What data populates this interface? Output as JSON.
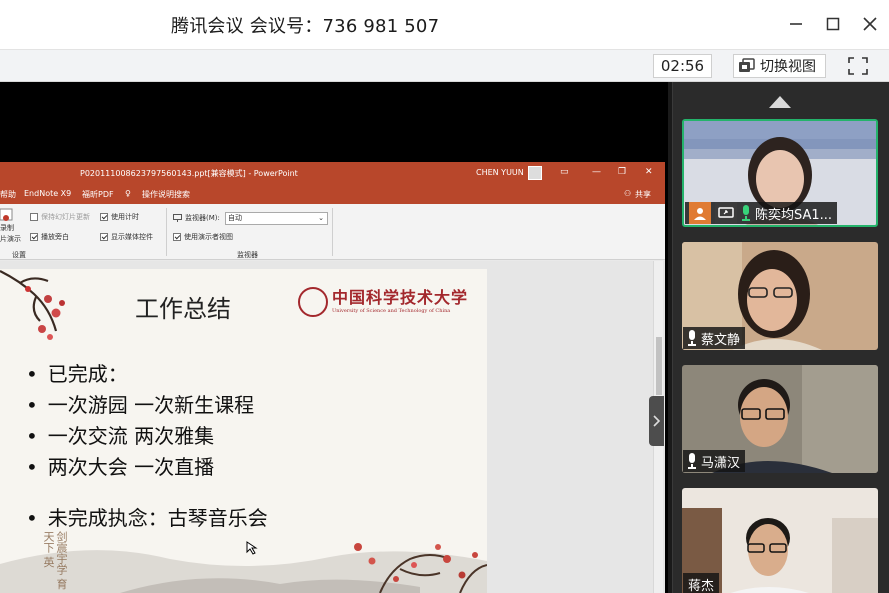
{
  "window": {
    "title": "腾讯会议 会议号：736 981 507"
  },
  "toolbar": {
    "timer": "02:56",
    "switch_view_label": "切换视图"
  },
  "ppt": {
    "file_title": "P020111008623797560143.ppt[兼容模式] - PowerPoint",
    "user": "CHEN YUUN",
    "menu": {
      "help": "帮助",
      "endnote": "EndNote X9",
      "foxit": "福昕PDF",
      "tell_me": "操作说明搜索",
      "share": "共享"
    },
    "ribbon": {
      "record_label_1": "录制",
      "record_label_2": "片演示",
      "keep_slides_updated": "保持幻灯片更新",
      "use_timings": "使用计时",
      "play_narrations": "播放旁白",
      "show_media_controls": "显示媒体控件",
      "group_setup": "设置",
      "monitor_label": "监视器(M):",
      "monitor_value": "自动",
      "use_presenter_view": "使用演示者视图",
      "group_monitors": "监视器"
    }
  },
  "slide": {
    "title": "工作总结",
    "university_cn": "中国科学技术大学",
    "university_en": "University of Science and Technology of China",
    "bullets_done": [
      "已完成：",
      "一次游园 一次新生课程",
      "一次交流 两次雅集",
      "两次大会 一次直播"
    ],
    "bullets_todo": [
      "未完成执念：古琴音乐会"
    ],
    "motto": "剑震宇学 育天下 英"
  },
  "participants": [
    {
      "name": "陈奕均SA1...",
      "role": "host"
    },
    {
      "name": "蔡文静"
    },
    {
      "name": "马潇汉"
    },
    {
      "name": "蒋杰"
    }
  ],
  "colors": {
    "ppt_red": "#b8472b",
    "active_border": "#24b36b",
    "ustc_red": "#a3282d"
  }
}
